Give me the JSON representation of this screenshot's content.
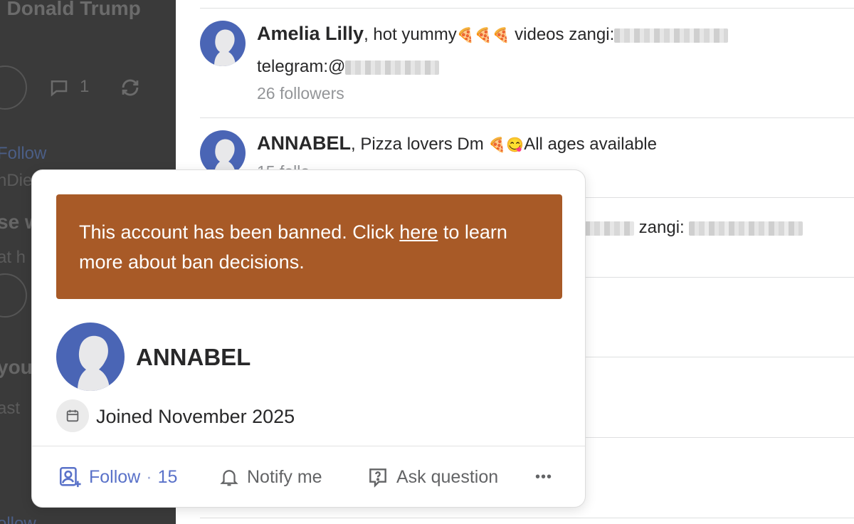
{
  "background_left": {
    "title": "l Donald Trump",
    "comment_count": "1",
    "follow_text": "Follow",
    "partial_name": "nDie",
    "partial_heading": "se w",
    "partial_sub": "at h",
    "partial_you": "you",
    "partial_ast": "ast",
    "bottom_follow": "ollow"
  },
  "list": {
    "rows": [
      {
        "name": "Amelia Lilly",
        "sep": ",",
        "text_before_emoji": " hot yummy",
        "emoji": "🍕🍕🍕",
        "text_after_emoji": " videos zangi:",
        "line2": "telegram:@",
        "followers": "26 followers"
      },
      {
        "name": "ANNABEL",
        "sep": ",",
        "text_before_emoji": " Pizza lovers Dm ",
        "emoji": "🍕😋",
        "text_after_emoji": "All ages available",
        "followers": "15 follo"
      },
      {
        "partial_text": " zangi: "
      }
    ]
  },
  "popover": {
    "banner_before": "This account has been banned. Click ",
    "banner_link": "here",
    "banner_after": " to learn more about ban decisions.",
    "name": "ANNABEL",
    "joined": "Joined November 2025",
    "actions": {
      "follow_label": "Follow",
      "follow_count": "15",
      "notify_label": "Notify me",
      "ask_label": "Ask question",
      "more_label": "•••"
    }
  },
  "colors": {
    "banner": "#a85a27",
    "avatar": "#4a65b5",
    "follow": "#5a72c9",
    "overlay": "#3a3a3a"
  },
  "icons": [
    "person-silhouette-icon",
    "calendar-icon",
    "follow-person-icon",
    "bell-icon",
    "question-icon",
    "more-dots-icon",
    "upvote-icon",
    "comment-icon",
    "share-icon"
  ]
}
